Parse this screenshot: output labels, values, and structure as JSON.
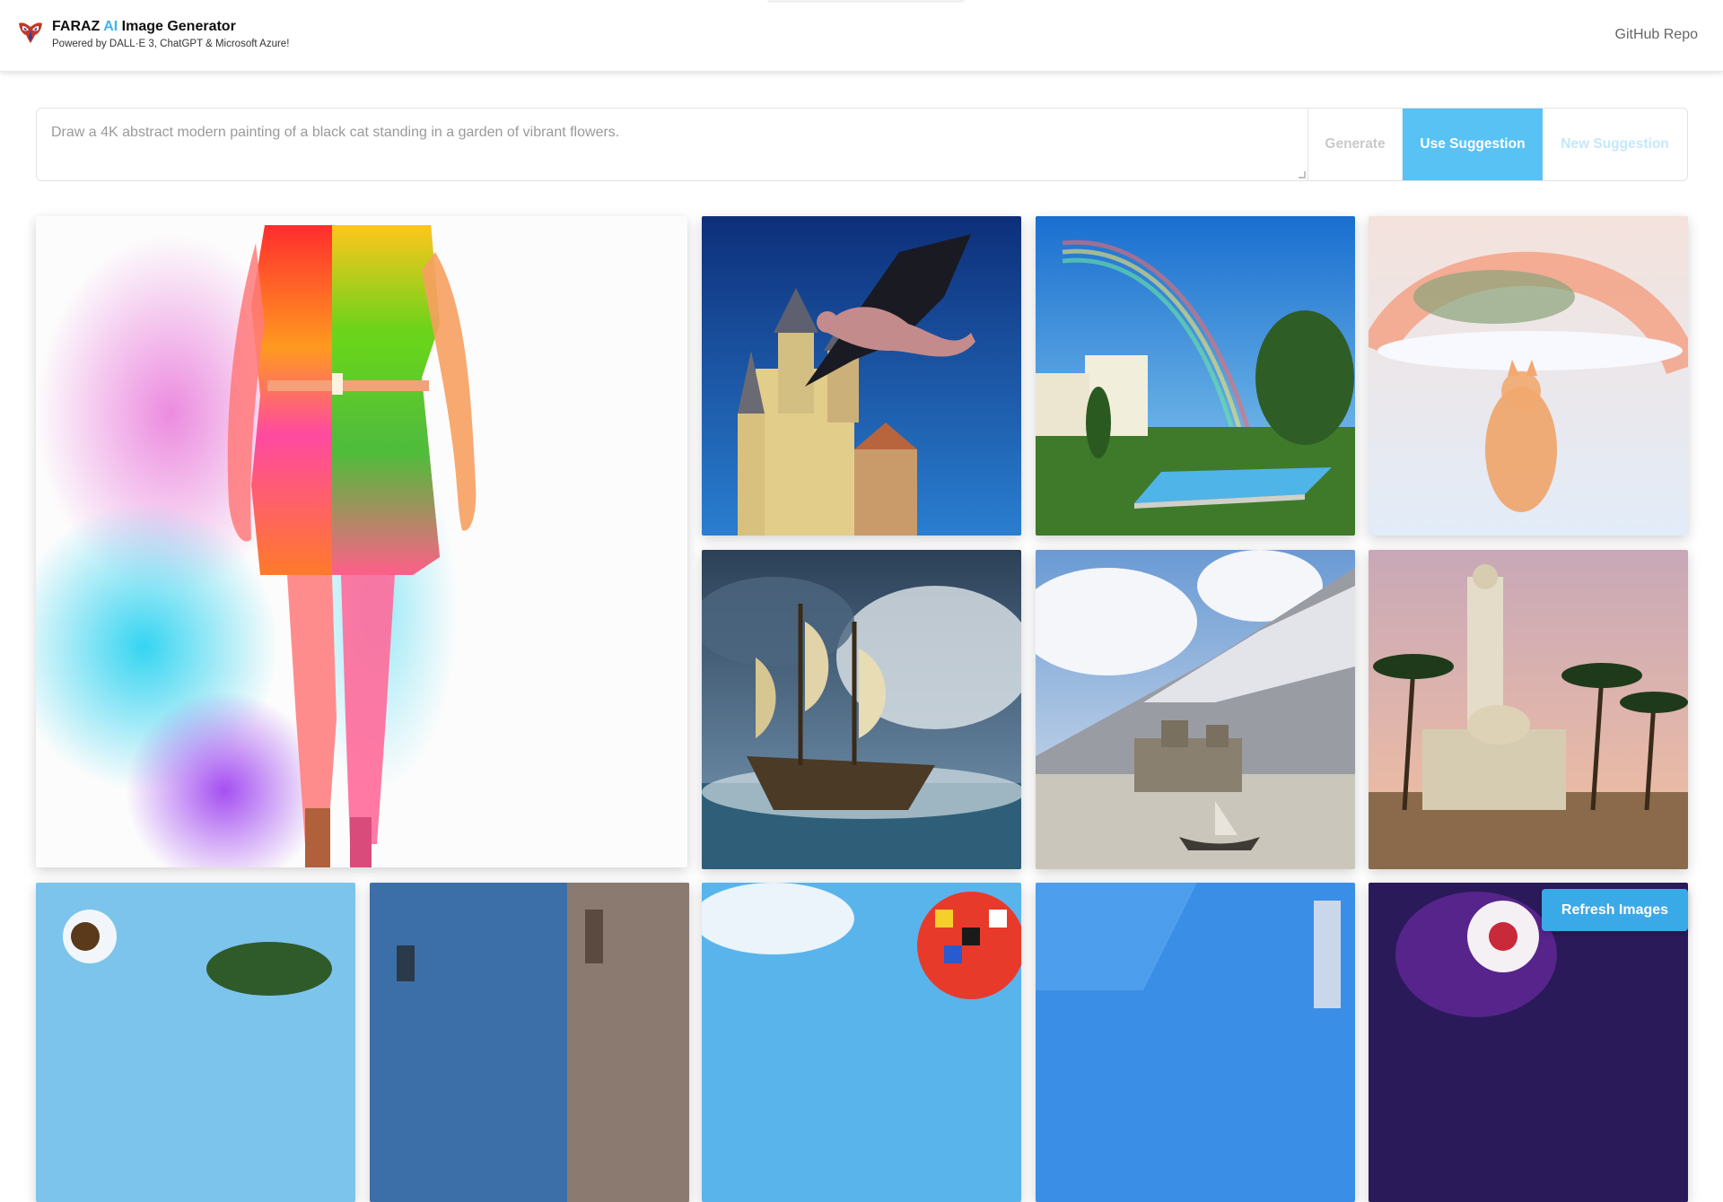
{
  "header": {
    "brand_name": "FARAZ",
    "brand_ai": "AI",
    "brand_rest": "Image Generator",
    "subtitle": "Powered by DALL·E 3, ChatGPT & Microsoft Azure!",
    "github_link": "GitHub Repo",
    "logo_icon": "mask-logo-icon"
  },
  "prompt": {
    "placeholder": "Draw a 4K abstract modern painting of a black cat standing in a garden of vibrant flowers.",
    "value": "",
    "generate_label": "Generate",
    "use_suggestion_label": "Use Suggestion",
    "new_suggestion_label": "New Suggestion"
  },
  "gallery": {
    "refresh_label": "Refresh Images"
  },
  "colors": {
    "accent": "#58c2f5",
    "accent_dark": "#3aa9e8",
    "ai_text": "#3fb3f0"
  }
}
